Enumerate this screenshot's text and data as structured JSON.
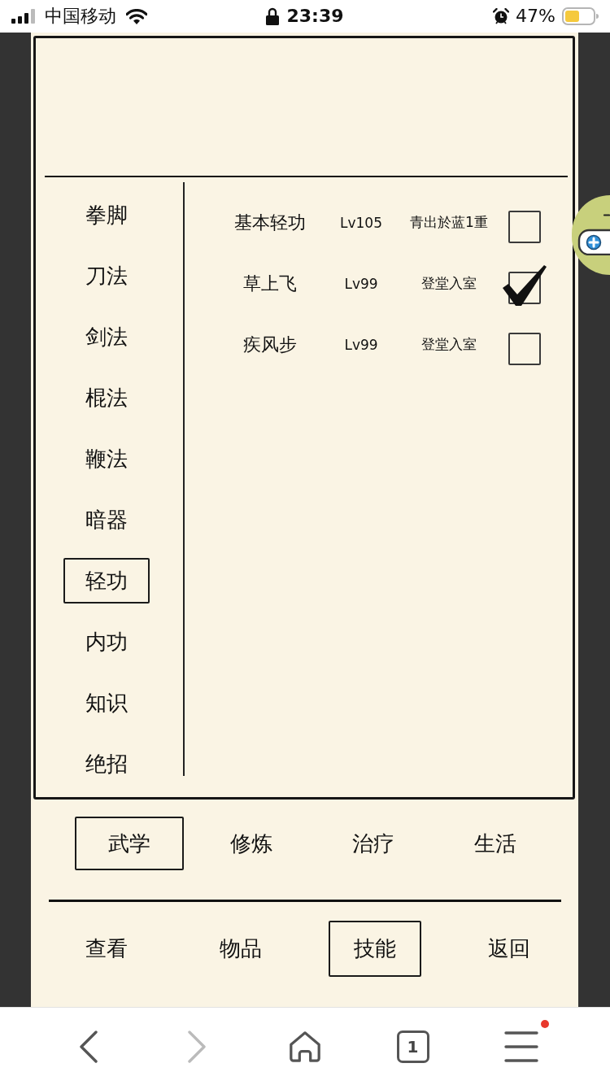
{
  "status_bar": {
    "carrier": "中国移动",
    "time": "23:39",
    "battery": "47%"
  },
  "categories": [
    {
      "label": "拳脚",
      "selected": false
    },
    {
      "label": "刀法",
      "selected": false
    },
    {
      "label": "剑法",
      "selected": false
    },
    {
      "label": "棍法",
      "selected": false
    },
    {
      "label": "鞭法",
      "selected": false
    },
    {
      "label": "暗器",
      "selected": false
    },
    {
      "label": "轻功",
      "selected": true
    },
    {
      "label": "内功",
      "selected": false
    },
    {
      "label": "知识",
      "selected": false
    },
    {
      "label": "绝招",
      "selected": false
    }
  ],
  "skills": [
    {
      "name": "基本轻功",
      "lv": "Lv105",
      "rank": "青出於蓝1重",
      "checked": false
    },
    {
      "name": "草上飞",
      "lv": "Lv99",
      "rank": "登堂入室",
      "checked": true
    },
    {
      "name": "疾风步",
      "lv": "Lv99",
      "rank": "登堂入室",
      "checked": false
    }
  ],
  "sub_tabs": [
    {
      "label": "武学",
      "selected": true
    },
    {
      "label": "修炼",
      "selected": false
    },
    {
      "label": "治疗",
      "selected": false
    },
    {
      "label": "生活",
      "selected": false
    }
  ],
  "nav_tabs": [
    {
      "label": "查看",
      "selected": false
    },
    {
      "label": "物品",
      "selected": false
    },
    {
      "label": "技能",
      "selected": true
    },
    {
      "label": "返回",
      "selected": false
    }
  ],
  "browser_toolbar": {
    "buttons": [
      {
        "kind": "back",
        "disabled": false,
        "badge": false
      },
      {
        "kind": "forward",
        "disabled": true,
        "badge": false
      },
      {
        "kind": "home",
        "disabled": false,
        "badge": false
      },
      {
        "kind": "tabs",
        "label": "1",
        "disabled": false,
        "badge": false
      },
      {
        "kind": "menu",
        "disabled": false,
        "badge": true
      }
    ]
  }
}
